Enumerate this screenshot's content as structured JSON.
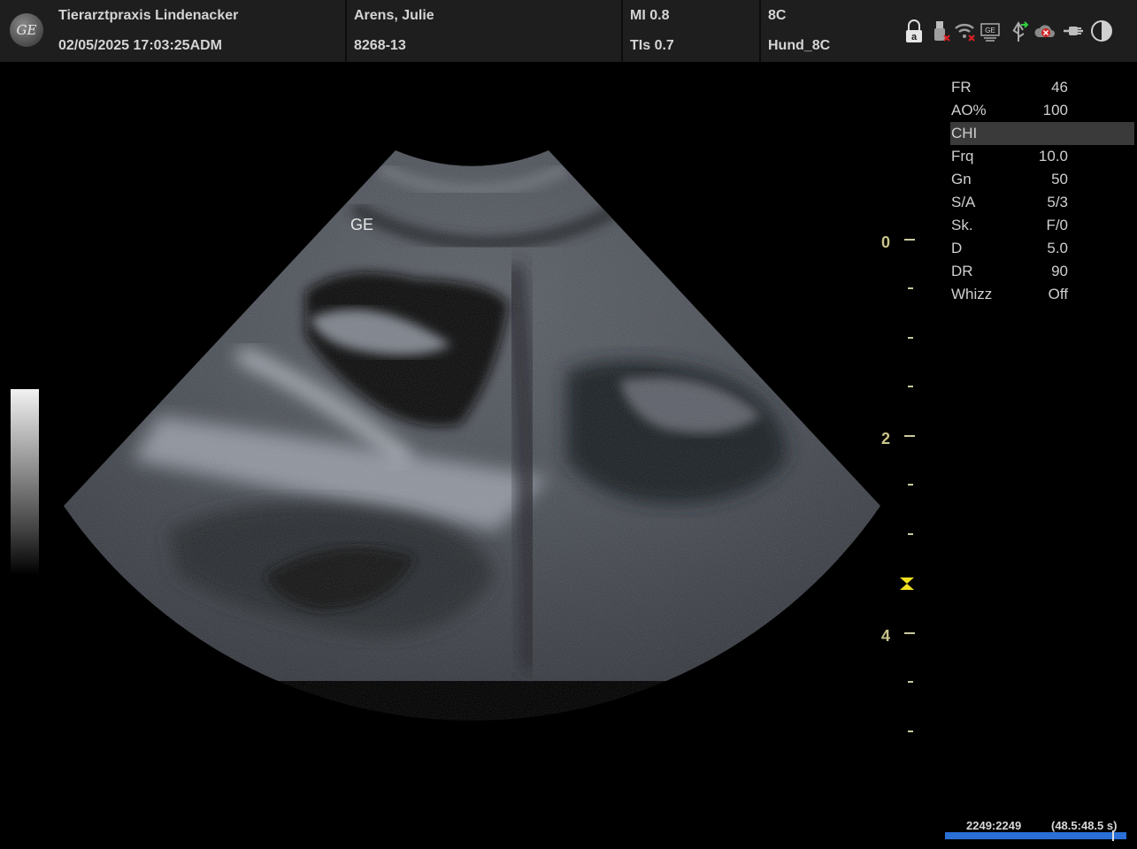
{
  "header": {
    "clinic": "Tierarztpraxis Lindenacker",
    "datetime": "02/05/2025 17:03:25ADM",
    "patient_name": "Arens, Julie",
    "patient_id": "8268-13",
    "mi": "MI 0.8",
    "tis": "TIs 0.7",
    "probe": "8C",
    "preset": "Hund_8C",
    "logo_text": "GE",
    "status_icons": [
      "lock-icon",
      "usb-icon",
      "wifi-icon",
      "network-icon",
      "usb-transfer-icon",
      "cloud-error-icon",
      "power-plug-icon",
      "brightness-icon"
    ]
  },
  "image": {
    "probe_label": "GE",
    "depth_labels": [
      "0",
      "2",
      "4"
    ]
  },
  "params": [
    {
      "label": "FR",
      "value": "46"
    },
    {
      "label": "AO%",
      "value": "100"
    },
    {
      "label": "CHI",
      "value": "",
      "highlight": true
    },
    {
      "label": "Frq",
      "value": "10.0"
    },
    {
      "label": "Gn",
      "value": "50"
    },
    {
      "label": "S/A",
      "value": "5/3"
    },
    {
      "label": "Sk.",
      "value": "F/0"
    },
    {
      "label": "D",
      "value": "5.0"
    },
    {
      "label": "DR",
      "value": "90"
    },
    {
      "label": "Whizz",
      "value": "Off"
    }
  ],
  "cine": {
    "frames": "2249:2249",
    "time": "(48.5:48.5 s)",
    "position": 1.0
  },
  "colors": {
    "header_bg": "#1e1e1e",
    "depth_scale": "#c9c48a",
    "focus_marker": "#f0e020",
    "cine_bar": "#2a6fd6"
  }
}
